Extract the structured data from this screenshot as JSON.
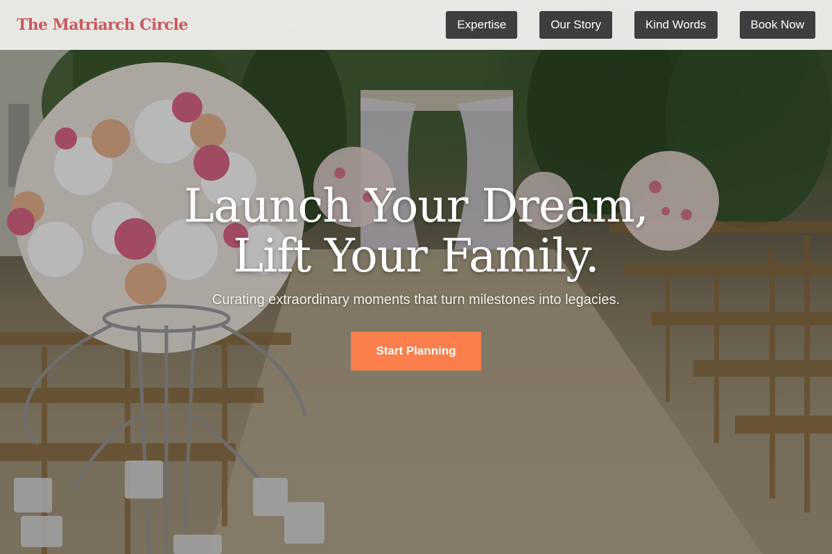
{
  "header": {
    "brand": "The Matriarch Circle",
    "nav": [
      {
        "label": "Expertise"
      },
      {
        "label": "Our Story"
      },
      {
        "label": "Kind Words"
      },
      {
        "label": "Book Now"
      }
    ]
  },
  "hero": {
    "headline_line1": "Launch Your Dream,",
    "headline_line2": "Lift Your Family.",
    "tagline": "Curating extraordinary moments that turn milestones into legacies.",
    "cta_label": "Start Planning",
    "background_image": "wedding-aisle-with-flower-arrangements"
  },
  "colors": {
    "brand": "#c9595f",
    "nav_button": "#3e3e3e",
    "cta": "#fa7f4c"
  }
}
